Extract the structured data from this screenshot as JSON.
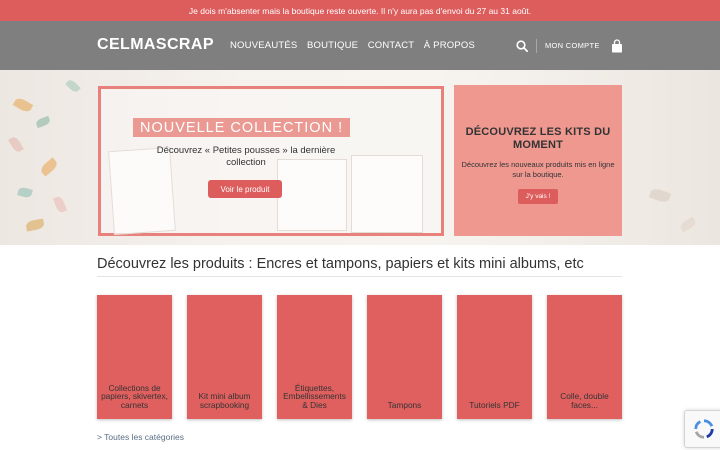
{
  "topbar": {
    "message": "Je dois m'absenter mais la boutique reste ouverte. Il n'y aura pas d'envoi du 27 au 31 août."
  },
  "header": {
    "logo": "CELMASCRAP",
    "nav": [
      "NOUVEAUTÉS",
      "BOUTIQUE",
      "CONTACT",
      "À PROPOS"
    ],
    "account": "MON COMPTE"
  },
  "hero": {
    "left": {
      "title": "NOUVELLE COLLECTION !",
      "text": "Découvrez « Petites pousses » la dernière collection",
      "button": "Voir le produit"
    },
    "right": {
      "title": "DÉCOUVREZ LES KITS DU MOMENT",
      "text": "Découvrez les nouveaux produits mis en ligne sur la boutique.",
      "button": "J'y vais !"
    }
  },
  "products": {
    "heading": "Découvrez les produits : Encres et tampons, papiers et kits mini albums, etc",
    "categories": [
      "Collections de papiers, skivertex, carnets",
      "Kit mini album scrapbooking",
      "Étiquettes, Embellissements & Dies",
      "Tampons",
      "Tutoriels PDF",
      "Colle, double faces..."
    ],
    "all_link": "> Toutes les catégories"
  },
  "colors": {
    "accent": "#dd5c5c",
    "header_bg": "#7f7f7f",
    "promo_pink": "#ee9890",
    "card_red": "#e0605f"
  },
  "icons": {
    "search": "search-icon",
    "cart": "shopping-bag-icon",
    "captcha": "recaptcha-icon"
  }
}
